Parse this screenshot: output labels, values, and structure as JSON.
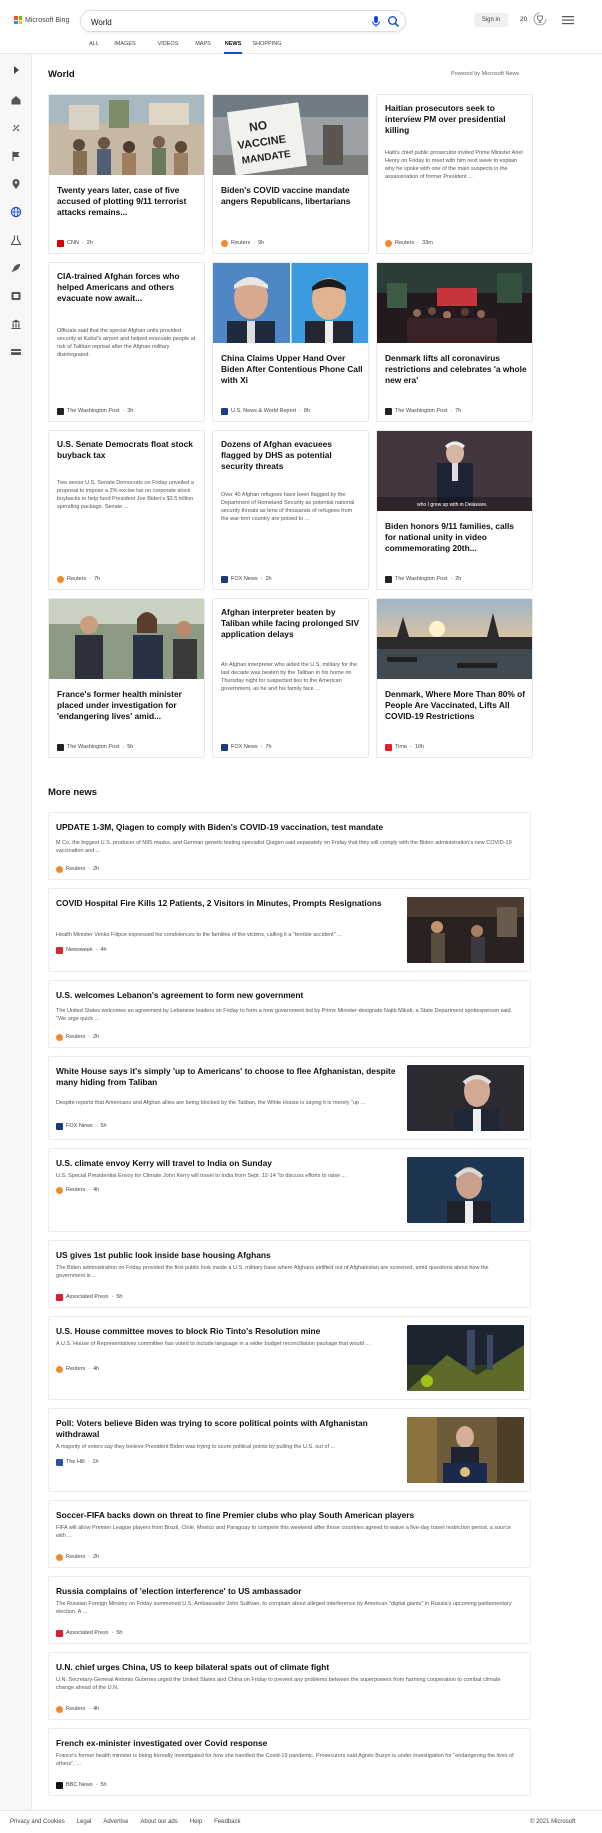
{
  "header": {
    "logo_text": "Microsoft Bing",
    "search_value": "World",
    "sign_in": "Sign in",
    "rewards_count": "20",
    "tabs": [
      "ALL",
      "IMAGES",
      "VIDEOS",
      "MAPS",
      "NEWS",
      "SHOPPING"
    ],
    "active_tab": "NEWS"
  },
  "world": {
    "title": "World",
    "powered_by": "Powered by Microsoft News",
    "cards": [
      {
        "title": "Twenty years later, case of five accused of plotting 9/11 terrorist attacks remains...",
        "snippet": "",
        "source": "CNN",
        "time": "2h",
        "logo_color": "#cc0000"
      },
      {
        "title": "Biden's COVID vaccine mandate angers Republicans, libertarians",
        "snippet": "",
        "source": "Reuters",
        "time": "9h",
        "logo_color": "#f08a2c"
      },
      {
        "title": "Haitian prosecutors seek to interview PM over presidential killing",
        "snippet": "Haiti's chief public prosecutor invited Prime Minister Ariel Henry on Friday to meet with him next week to explain why he spoke with one of the main suspects in the assassination of former President ...",
        "source": "Reuters",
        "time": "33m",
        "logo_color": "#f08a2c"
      },
      {
        "title": "CIA-trained Afghan forces who helped Americans and others evacuate now await...",
        "snippet": "Officials said that the special Afghan units provided security at Kabul's airport and helped evacuate people at risk of Taliban reprisal after the Afghan military disintegrated.",
        "source": "The Washington Post",
        "time": "3h",
        "logo_color": "#222222"
      },
      {
        "title": "China Claims Upper Hand Over Biden After Contentious Phone Call with Xi",
        "snippet": "",
        "source": "U.S. News & World Report",
        "time": "8h",
        "logo_color": "#1b3f8f"
      },
      {
        "title": "Denmark lifts all coronavirus restrictions and celebrates 'a whole new era'",
        "snippet": "",
        "source": "The Washington Post",
        "time": "7h",
        "logo_color": "#222222"
      },
      {
        "title": "U.S. Senate Democrats float stock buyback tax",
        "snippet": "Two senior U.S. Senate Democrats on Friday unveiled a proposal to impose a 2% excise tax on corporate stock buybacks to help fund President Joe Biden's $3.5 trillion spending package. Senate ...",
        "source": "Reuters",
        "time": "7h",
        "logo_color": "#f08a2c"
      },
      {
        "title": "Dozens of Afghan evacuees flagged by DHS as potential security threats",
        "snippet": "Over 40 Afghan refugees have been flagged by the Department of Homeland Security as potential national security threats as tens of thousands of refugees from the war-torn country are poised to ...",
        "source": "FOX News",
        "time": "2h",
        "logo_color": "#183c7a"
      },
      {
        "title": "Biden honors 9/11 families, calls for national unity in video commemorating 20th...",
        "snippet": "",
        "source": "The Washington Post",
        "time": "2h",
        "logo_color": "#222222",
        "image_caption": "who I grew up with in Delaware."
      },
      {
        "title": "France's former health minister placed under investigation for 'endangering lives' amid...",
        "snippet": "",
        "source": "The Washington Post",
        "time": "5h",
        "logo_color": "#222222"
      },
      {
        "title": "Afghan interpreter beaten by Taliban while facing prolonged SIV application delays",
        "snippet": "An Afghan interpreter who aided the U.S. military for the last decade was beaten by the Taliban in his home on Thursday night for suspected ties to the American government, as he and his family face ...",
        "source": "FOX News",
        "time": "7h",
        "logo_color": "#183c7a"
      },
      {
        "title": "Denmark, Where More Than 80% of People Are Vaccinated, Lifts All COVID-19 Restrictions",
        "snippet": "",
        "source": "Time",
        "time": "10h",
        "logo_color": "#e4212b"
      }
    ],
    "no_vaccine_sign": [
      "NO",
      "VACCINE",
      "MANDATE"
    ]
  },
  "more_news": {
    "title": "More news",
    "items": [
      {
        "title": "UPDATE 1-3M, Qiagen to comply with Biden's COVID-19 vaccination, test mandate",
        "snippet": "M Co, the biggest U.S. producer of N95 masks, and German genetic testing specialist Qiagen said separately on Friday that they will comply with the Biden administration's new COVID-19 vaccination and ...",
        "source": "Reuters",
        "time": "2h",
        "logo_color": "#f08a2c"
      },
      {
        "title": "COVID Hospital Fire Kills 12 Patients, 2 Visitors in Minutes, Prompts Resignations",
        "snippet": "Health Minister Venko Filipce expressed his condolences to the families of the victims, calling it a \"terrible accident\" ...",
        "source": "Newsweek",
        "time": "4h",
        "logo_color": "#d8262f"
      },
      {
        "title": "U.S. welcomes Lebanon's agreement to form new government",
        "snippet": "The United States welcomes an agreement by Lebanese leaders on Friday to form a new government led by Prime Minister-designate Najib Mikati, a State Department spokesperson said. \"We urge quick ...",
        "source": "Reuters",
        "time": "2h",
        "logo_color": "#f08a2c"
      },
      {
        "title": "White House says it's simply 'up to Americans' to choose to flee Afghanistan, despite many hiding from Taliban",
        "snippet": "Despite reports that Americans and Afghan allies are being blocked by the Taliban, the White House is saying it is merely \"up ...",
        "source": "FOX News",
        "time": "5h",
        "logo_color": "#183c7a"
      },
      {
        "title": "U.S. climate envoy Kerry will travel to India on Sunday",
        "snippet": "U.S. Special Presidential Envoy for Climate John Kerry will travel to India from Sept. 12-14 \"to discuss efforts to raise ...",
        "source": "Reuters",
        "time": "4h",
        "logo_color": "#f08a2c"
      },
      {
        "title": "US gives 1st public look inside base housing Afghans",
        "snippet": "The Biden administration on Friday provided the first public look inside a U.S. military base where Afghans airlifted out of Afghanistan are screened, amid questions about how the government is ...",
        "source": "Associated Press",
        "time": "5h",
        "logo_color": "#e21b2e"
      },
      {
        "title": "U.S. House committee moves to block Rio Tinto's Resolution mine",
        "snippet": "A U.S. House of Representatives committee has voted to include language in a wider budget reconciliation package that would ...",
        "source": "Reuters",
        "time": "4h",
        "logo_color": "#f08a2c"
      },
      {
        "title": "Poll: Voters believe Biden was trying to score political points with Afghanistan withdrawal",
        "snippet": "A majority of voters say they believe President Biden was trying to score political points by pulling the U.S. out of ...",
        "source": "The Hill",
        "time": "1h",
        "logo_color": "#2850a8"
      },
      {
        "title": "Soccer-FIFA backs down on threat to fine Premier clubs who play South American players",
        "snippet": "FIFA will allow Premier League players from Brazil, Chile, Mexico and Paraguay to compete this weekend after those countries agreed to waive a five-day travel restriction period, a source with ...",
        "source": "Reuters",
        "time": "2h",
        "logo_color": "#f08a2c"
      },
      {
        "title": "Russia complains of 'election interference' to US ambassador",
        "snippet": "The Russian Foreign Ministry on Friday summoned U.S. Ambassador John Sullivan, to complain about alleged interference by American \"digital giants\" in Russia's upcoming parliamentary election. A ...",
        "source": "Associated Press",
        "time": "5h",
        "logo_color": "#e21b2e"
      },
      {
        "title": "U.N. chief urges China, US to keep bilateral spats out of climate fight",
        "snippet": "U.N. Secretary-General Antonio Guterres urged the United States and China on Friday to prevent any problems between the superpowers from harming cooperation to combat climate change ahead of the U.N.",
        "source": "Reuters",
        "time": "4h",
        "logo_color": "#f08a2c"
      },
      {
        "title": "French ex-minister investigated over Covid response",
        "snippet": "France's former health minister is being formally investigated for how she handled the Covid-19 pandemic. Prosecutors said Agnès Buzyn is under investigation for \"endangering the lives of others\", ...",
        "source": "BBC News",
        "time": "5h",
        "logo_color": "#111111"
      }
    ]
  },
  "footer": {
    "links": [
      "Privacy and Cookies",
      "Legal",
      "Advertise",
      "About our ads",
      "Help",
      "Feedback"
    ],
    "copyright": "© 2021 Microsoft"
  },
  "colors": {
    "accent": "#174ae4",
    "sidebar_bg": "#f7f7f7"
  }
}
